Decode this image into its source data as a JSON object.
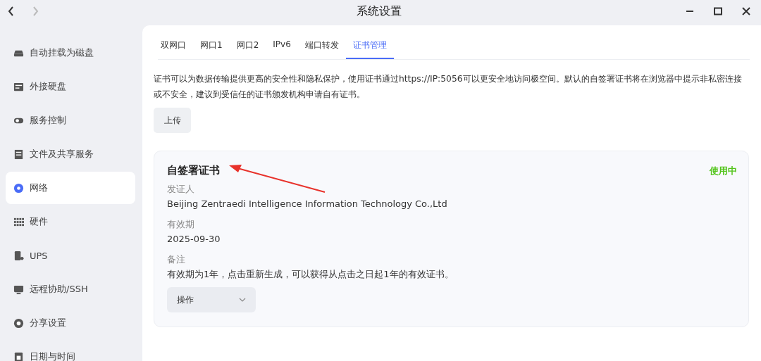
{
  "window": {
    "title": "系统设置"
  },
  "sidebar": {
    "items": [
      {
        "label": "自动挂载为磁盘",
        "selected": false
      },
      {
        "label": "外接硬盘",
        "selected": false
      },
      {
        "label": "服务控制",
        "selected": false
      },
      {
        "label": "文件及共享服务",
        "selected": false
      },
      {
        "label": "网络",
        "selected": true
      },
      {
        "label": "硬件",
        "selected": false
      },
      {
        "label": "UPS",
        "selected": false
      },
      {
        "label": "远程协助/SSH",
        "selected": false
      },
      {
        "label": "分享设置",
        "selected": false
      },
      {
        "label": "日期与时间",
        "selected": false
      }
    ]
  },
  "tabs": [
    {
      "label": "双网口",
      "selected": false
    },
    {
      "label": "网口1",
      "selected": false
    },
    {
      "label": "网口2",
      "selected": false
    },
    {
      "label": "IPv6",
      "selected": false
    },
    {
      "label": "端口转发",
      "selected": false
    },
    {
      "label": "证书管理",
      "selected": true
    }
  ],
  "description": "证书可以为数据传输提供更高的安全性和隐私保护，使用证书通过https://IP:5056可以更安全地访问极空间。默认的自签署证书将在浏览器中提示非私密连接或不安全，建议到受信任的证书颁发机构申请自有证书。",
  "upload_button": "上传",
  "certificate": {
    "title": "自签署证书",
    "status": "使用中",
    "in_use": true,
    "fields": [
      {
        "label": "发证人",
        "value": "Beijing Zentraedi Intelligence Information Technology Co.,Ltd"
      },
      {
        "label": "有效期",
        "value": "2025-09-30"
      },
      {
        "label": "备注",
        "value": "有效期为1年，点击重新生成，可以获得从点击之日起1年的有效证书。"
      }
    ],
    "action": "操作"
  }
}
